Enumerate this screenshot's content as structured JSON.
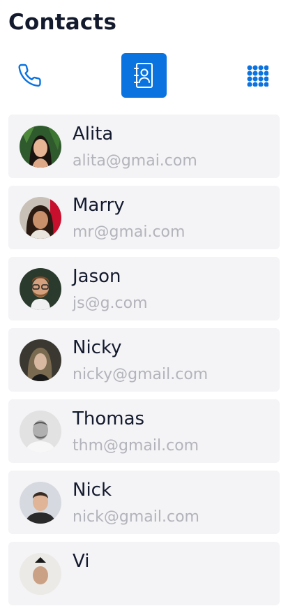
{
  "header": {
    "title": "Contacts"
  },
  "toolbar": {
    "buttons": [
      {
        "icon": "phone-icon",
        "active": false
      },
      {
        "icon": "contact-book-icon",
        "active": true
      },
      {
        "icon": "dialpad-grid-icon",
        "active": false
      }
    ],
    "accent_color": "#0a73e0"
  },
  "contacts": [
    {
      "name": "Alita",
      "email": "alita@gmai.com"
    },
    {
      "name": "Marry",
      "email": "mr@gmai.com"
    },
    {
      "name": "Jason",
      "email": "js@g.com"
    },
    {
      "name": "Nicky",
      "email": "nicky@gmail.com"
    },
    {
      "name": "Thomas",
      "email": "thm@gmail.com"
    },
    {
      "name": "Nick",
      "email": "nick@gmail.com"
    },
    {
      "name": "Vi",
      "email": ""
    }
  ]
}
